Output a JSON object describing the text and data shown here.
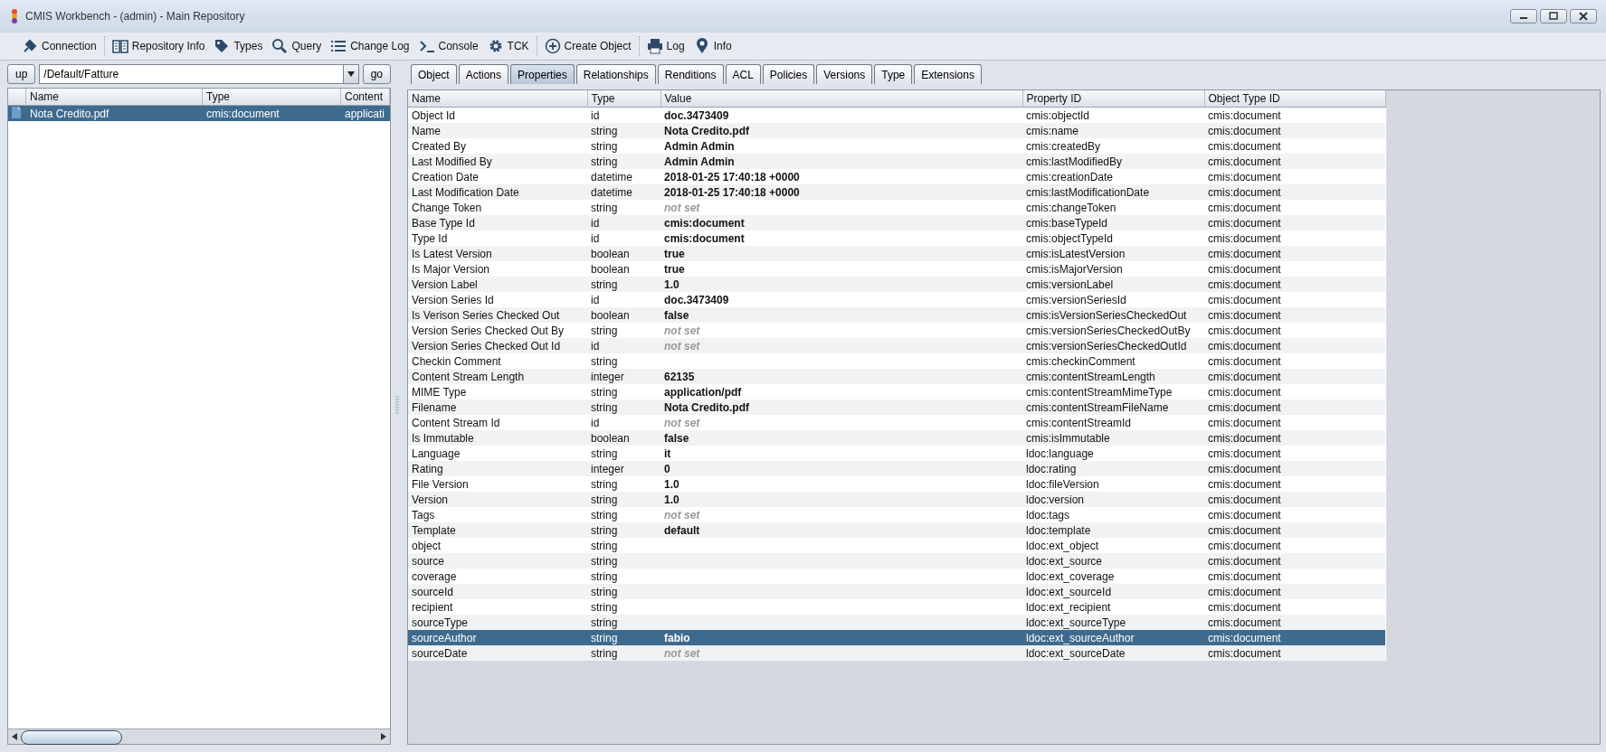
{
  "window": {
    "title": "CMIS Workbench - (admin) - Main Repository"
  },
  "toolbar": [
    [
      {
        "label": "Connection"
      }
    ],
    [
      {
        "label": "Repository Info"
      },
      {
        "label": "Types"
      },
      {
        "label": "Query"
      },
      {
        "label": "Change Log"
      },
      {
        "label": "Console"
      },
      {
        "label": "TCK"
      }
    ],
    [
      {
        "label": "Create Object"
      }
    ],
    [
      {
        "label": "Log"
      },
      {
        "label": "Info"
      }
    ]
  ],
  "navigation": {
    "up_button": "up",
    "path": "/Default/Fatture",
    "go_button": "go"
  },
  "folder_table": {
    "columns": [
      "Name",
      "Type",
      "Content"
    ],
    "rows": [
      {
        "cells": [
          "Nota Credito.pdf",
          "cmis:document",
          "applicati"
        ],
        "selected": true
      }
    ]
  },
  "tabs": [
    {
      "label": "Object",
      "selected": false
    },
    {
      "label": "Actions",
      "selected": false
    },
    {
      "label": "Properties",
      "selected": true
    },
    {
      "label": "Relationships",
      "selected": false
    },
    {
      "label": "Renditions",
      "selected": false
    },
    {
      "label": "ACL",
      "selected": false
    },
    {
      "label": "Policies",
      "selected": false
    },
    {
      "label": "Versions",
      "selected": false
    },
    {
      "label": "Type",
      "selected": false
    },
    {
      "label": "Extensions",
      "selected": false
    }
  ],
  "properties_table": {
    "columns": [
      "Name",
      "Type",
      "Value",
      "Property ID",
      "Object Type ID"
    ],
    "rows": [
      {
        "name": "Object Id",
        "type": "id",
        "value": "doc.3473409",
        "kind": "set",
        "property_id": "cmis:objectId",
        "object_type_id": "cmis:document",
        "selected": false
      },
      {
        "name": "Name",
        "type": "string",
        "value": "Nota Credito.pdf",
        "kind": "set",
        "property_id": "cmis:name",
        "object_type_id": "cmis:document",
        "selected": false
      },
      {
        "name": "Created By",
        "type": "string",
        "value": "Admin Admin",
        "kind": "set",
        "property_id": "cmis:createdBy",
        "object_type_id": "cmis:document",
        "selected": false
      },
      {
        "name": "Last Modified By",
        "type": "string",
        "value": "Admin Admin",
        "kind": "set",
        "property_id": "cmis:lastModifiedBy",
        "object_type_id": "cmis:document",
        "selected": false
      },
      {
        "name": "Creation Date",
        "type": "datetime",
        "value": "2018-01-25 17:40:18 +0000",
        "kind": "set",
        "property_id": "cmis:creationDate",
        "object_type_id": "cmis:document",
        "selected": false
      },
      {
        "name": "Last Modification Date",
        "type": "datetime",
        "value": "2018-01-25 17:40:18 +0000",
        "kind": "set",
        "property_id": "cmis:lastModificationDate",
        "object_type_id": "cmis:document",
        "selected": false
      },
      {
        "name": "Change Token",
        "type": "string",
        "value": "not set",
        "kind": "unset",
        "property_id": "cmis:changeToken",
        "object_type_id": "cmis:document",
        "selected": false
      },
      {
        "name": "Base Type Id",
        "type": "id",
        "value": "cmis:document",
        "kind": "set",
        "property_id": "cmis:baseTypeId",
        "object_type_id": "cmis:document",
        "selected": false
      },
      {
        "name": "Type Id",
        "type": "id",
        "value": "cmis:document",
        "kind": "set",
        "property_id": "cmis:objectTypeId",
        "object_type_id": "cmis:document",
        "selected": false
      },
      {
        "name": "Is Latest Version",
        "type": "boolean",
        "value": "true",
        "kind": "set",
        "property_id": "cmis:isLatestVersion",
        "object_type_id": "cmis:document",
        "selected": false
      },
      {
        "name": "Is Major Version",
        "type": "boolean",
        "value": "true",
        "kind": "set",
        "property_id": "cmis:isMajorVersion",
        "object_type_id": "cmis:document",
        "selected": false
      },
      {
        "name": "Version Label",
        "type": "string",
        "value": "1.0",
        "kind": "set",
        "property_id": "cmis:versionLabel",
        "object_type_id": "cmis:document",
        "selected": false
      },
      {
        "name": "Version Series Id",
        "type": "id",
        "value": "doc.3473409",
        "kind": "set",
        "property_id": "cmis:versionSeriesId",
        "object_type_id": "cmis:document",
        "selected": false
      },
      {
        "name": "Is Verison Series Checked Out",
        "type": "boolean",
        "value": "false",
        "kind": "set",
        "property_id": "cmis:isVersionSeriesCheckedOut",
        "object_type_id": "cmis:document",
        "selected": false
      },
      {
        "name": "Version Series Checked Out By",
        "type": "string",
        "value": "not set",
        "kind": "unset",
        "property_id": "cmis:versionSeriesCheckedOutBy",
        "object_type_id": "cmis:document",
        "selected": false
      },
      {
        "name": "Version Series Checked Out Id",
        "type": "id",
        "value": "not set",
        "kind": "unset",
        "property_id": "cmis:versionSeriesCheckedOutId",
        "object_type_id": "cmis:document",
        "selected": false
      },
      {
        "name": "Checkin Comment",
        "type": "string",
        "kind": "empty",
        "property_id": "cmis:checkinComment",
        "object_type_id": "cmis:document",
        "selected": false
      },
      {
        "name": "Content Stream Length",
        "type": "integer",
        "value": "62135",
        "kind": "set",
        "property_id": "cmis:contentStreamLength",
        "object_type_id": "cmis:document",
        "selected": false
      },
      {
        "name": "MIME Type",
        "type": "string",
        "value": "application/pdf",
        "kind": "set",
        "property_id": "cmis:contentStreamMimeType",
        "object_type_id": "cmis:document",
        "selected": false
      },
      {
        "name": "Filename",
        "type": "string",
        "value": "Nota Credito.pdf",
        "kind": "set",
        "property_id": "cmis:contentStreamFileName",
        "object_type_id": "cmis:document",
        "selected": false
      },
      {
        "name": "Content Stream Id",
        "type": "id",
        "value": "not set",
        "kind": "unset",
        "property_id": "cmis:contentStreamId",
        "object_type_id": "cmis:document",
        "selected": false
      },
      {
        "name": "Is Immutable",
        "type": "boolean",
        "value": "false",
        "kind": "set",
        "property_id": "cmis:isImmutable",
        "object_type_id": "cmis:document",
        "selected": false
      },
      {
        "name": "Language",
        "type": "string",
        "value": "it",
        "kind": "set",
        "property_id": "ldoc:language",
        "object_type_id": "cmis:document",
        "selected": false
      },
      {
        "name": "Rating",
        "type": "integer",
        "value": "0",
        "kind": "set",
        "property_id": "ldoc:rating",
        "object_type_id": "cmis:document",
        "selected": false
      },
      {
        "name": "File Version",
        "type": "string",
        "value": "1.0",
        "kind": "set",
        "property_id": "ldoc:fileVersion",
        "object_type_id": "cmis:document",
        "selected": false
      },
      {
        "name": "Version",
        "type": "string",
        "value": "1.0",
        "kind": "set",
        "property_id": "ldoc:version",
        "object_type_id": "cmis:document",
        "selected": false
      },
      {
        "name": "Tags",
        "type": "string",
        "value": "not set",
        "kind": "unset",
        "property_id": "ldoc:tags",
        "object_type_id": "cmis:document",
        "selected": false
      },
      {
        "name": "Template",
        "type": "string",
        "value": "default",
        "kind": "set",
        "property_id": "ldoc:template",
        "object_type_id": "cmis:document",
        "selected": false
      },
      {
        "name": "object",
        "type": "string",
        "kind": "empty",
        "property_id": "ldoc:ext_object",
        "object_type_id": "cmis:document",
        "selected": false
      },
      {
        "name": "source",
        "type": "string",
        "kind": "empty",
        "property_id": "ldoc:ext_source",
        "object_type_id": "cmis:document",
        "selected": false
      },
      {
        "name": "coverage",
        "type": "string",
        "kind": "empty",
        "property_id": "ldoc:ext_coverage",
        "object_type_id": "cmis:document",
        "selected": false
      },
      {
        "name": "sourceId",
        "type": "string",
        "kind": "empty",
        "property_id": "ldoc:ext_sourceId",
        "object_type_id": "cmis:document",
        "selected": false
      },
      {
        "name": "recipient",
        "type": "string",
        "kind": "empty",
        "property_id": "ldoc:ext_recipient",
        "object_type_id": "cmis:document",
        "selected": false
      },
      {
        "name": "sourceType",
        "type": "string",
        "kind": "empty",
        "property_id": "ldoc:ext_sourceType",
        "object_type_id": "cmis:document",
        "selected": false
      },
      {
        "name": "sourceAuthor",
        "type": "string",
        "value": "fabio",
        "kind": "set",
        "property_id": "ldoc:ext_sourceAuthor",
        "object_type_id": "cmis:document",
        "selected": true
      },
      {
        "name": "sourceDate",
        "type": "string",
        "value": "not set",
        "kind": "unset",
        "property_id": "ldoc:ext_sourceDate",
        "object_type_id": "cmis:document",
        "selected": false
      }
    ]
  }
}
